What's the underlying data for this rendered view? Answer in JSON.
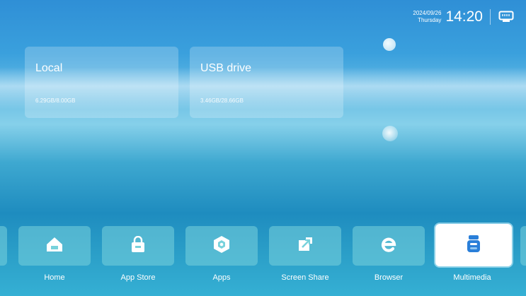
{
  "status": {
    "date": "2024/09/26",
    "weekday": "Thursday",
    "time": "14:20",
    "network_icon": "ethernet-icon"
  },
  "storage": [
    {
      "title": "Local",
      "usage": "6.29GB/8.00GB"
    },
    {
      "title": "USB drive",
      "usage": "3.46GB/28.66GB"
    }
  ],
  "dock": {
    "items": [
      {
        "label": "Home",
        "icon": "home-icon"
      },
      {
        "label": "App Store",
        "icon": "shopping-bag-icon"
      },
      {
        "label": "Apps",
        "icon": "apps-hexagon-icon"
      },
      {
        "label": "Screen Share",
        "icon": "screen-share-icon"
      },
      {
        "label": "Browser",
        "icon": "browser-e-icon"
      },
      {
        "label": "Multimedia",
        "icon": "multimedia-icon"
      }
    ],
    "selected": "Multimedia",
    "accent_color": "#2a7fd9"
  }
}
